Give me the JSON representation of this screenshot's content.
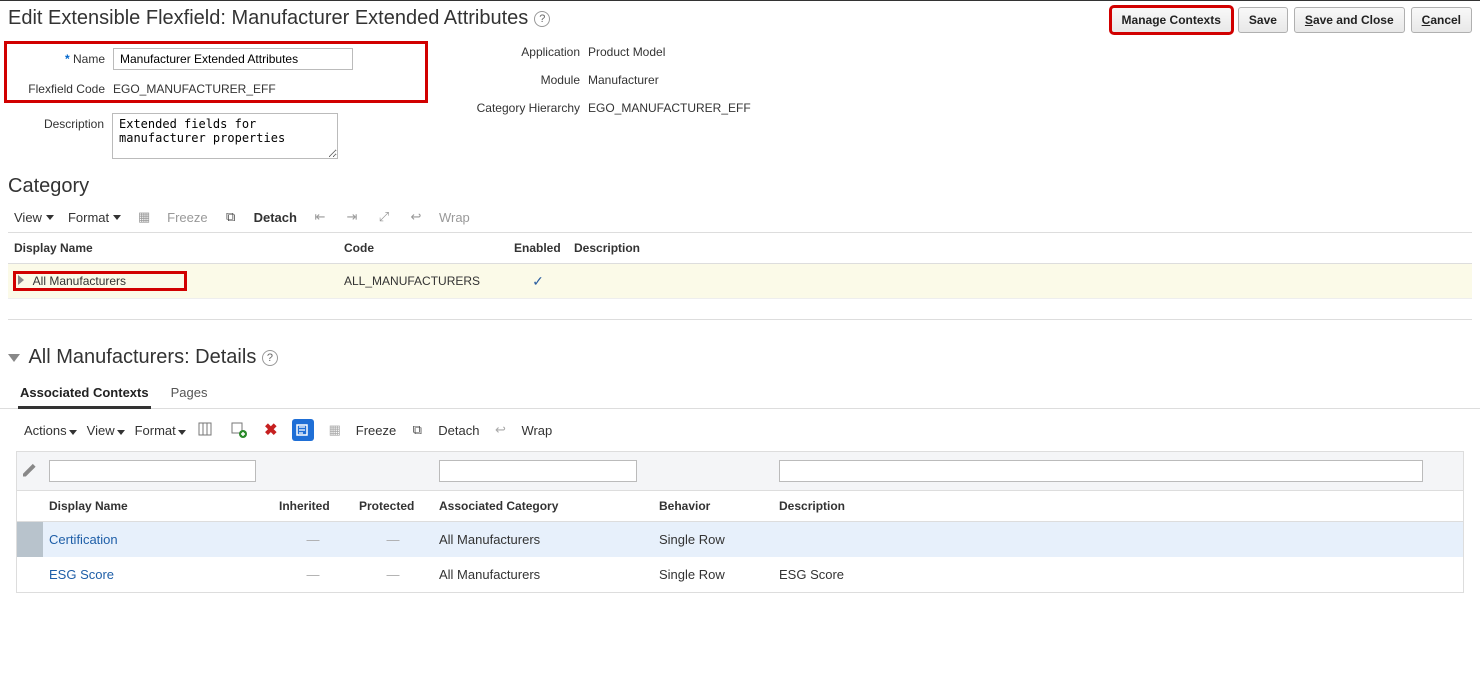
{
  "header": {
    "title": "Edit Extensible Flexfield: Manufacturer Extended Attributes",
    "buttons": {
      "manage_contexts": "Manage Contexts",
      "save": "Save",
      "save_close_prefix": "S",
      "save_close_rest": "ave and Close",
      "cancel_prefix": "C",
      "cancel_rest": "ancel"
    }
  },
  "form": {
    "name_label": "Name",
    "name_value": "Manufacturer Extended Attributes",
    "flexcode_label": "Flexfield Code",
    "flexcode_value": "EGO_MANUFACTURER_EFF",
    "description_label": "Description",
    "description_value": "Extended fields for manufacturer properties",
    "application_label": "Application",
    "application_value": "Product Model",
    "module_label": "Module",
    "module_value": "Manufacturer",
    "cat_hier_label": "Category Hierarchy",
    "cat_hier_value": "EGO_MANUFACTURER_EFF"
  },
  "category": {
    "heading": "Category",
    "toolbar": {
      "view": "View",
      "format": "Format",
      "freeze": "Freeze",
      "detach": "Detach",
      "wrap": "Wrap"
    },
    "columns": {
      "display_name": "Display Name",
      "code": "Code",
      "enabled": "Enabled",
      "description": "Description"
    },
    "rows": [
      {
        "display_name": "All Manufacturers",
        "code": "ALL_MANUFACTURERS",
        "enabled": true,
        "description": ""
      }
    ]
  },
  "details": {
    "heading": "All Manufacturers: Details",
    "tabs": {
      "associated_contexts": "Associated Contexts",
      "pages": "Pages"
    }
  },
  "contexts": {
    "toolbar": {
      "actions": "Actions",
      "view": "View",
      "format": "Format",
      "freeze": "Freeze",
      "detach": "Detach",
      "wrap": "Wrap"
    },
    "columns": {
      "display_name": "Display Name",
      "inherited": "Inherited",
      "protected": "Protected",
      "associated_category": "Associated Category",
      "behavior": "Behavior",
      "description": "Description"
    },
    "rows": [
      {
        "display_name": "Certification",
        "inherited": "—",
        "protected": "—",
        "associated_category": "All Manufacturers",
        "behavior": "Single Row",
        "description": ""
      },
      {
        "display_name": "ESG Score",
        "inherited": "—",
        "protected": "—",
        "associated_category": "All Manufacturers",
        "behavior": "Single Row",
        "description": "ESG Score"
      }
    ]
  }
}
